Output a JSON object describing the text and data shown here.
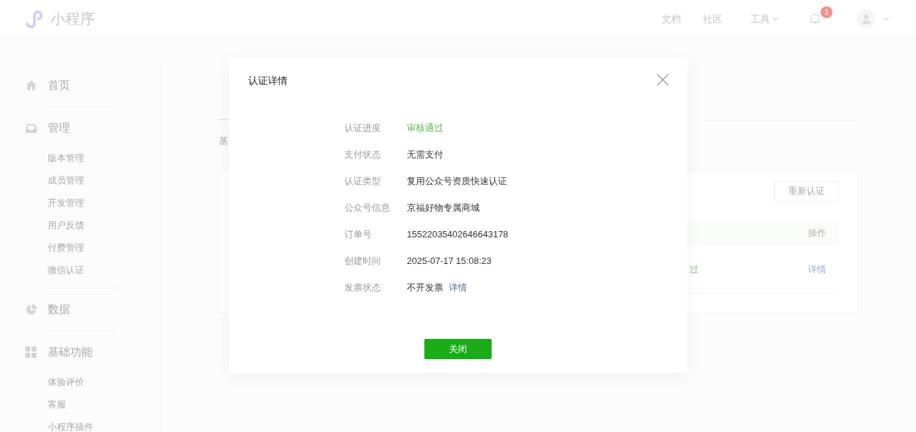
{
  "header": {
    "logo_text": "小程序",
    "nav": [
      {
        "label": "文档",
        "kind": "link"
      },
      {
        "label": "社区",
        "kind": "link"
      },
      {
        "label": "工具",
        "kind": "dropdown"
      }
    ],
    "notification_badge": "1"
  },
  "sidebar": [
    {
      "label": "首页"
    },
    {
      "label": "管理",
      "children": [
        "版本管理",
        "成员管理",
        "开发管理",
        "用户反馈",
        "付费管理",
        "微信认证"
      ]
    },
    {
      "label": "数据"
    },
    {
      "label": "基础功能",
      "children": [
        "体验评价",
        "客服",
        "小程序插件"
      ]
    }
  ],
  "main": {
    "tab": "基",
    "card": {
      "button": "重新认证",
      "table_header": "操作",
      "row": {
        "column_1": "过",
        "action": "详情"
      }
    }
  },
  "modal": {
    "title": "认证详情",
    "fields": [
      {
        "label": "认证进度",
        "value": "审核通过",
        "kind": "success"
      },
      {
        "label": "支付状态",
        "value": "无需支付",
        "kind": "plain"
      },
      {
        "label": "认证类型",
        "value": "复用公众号资质快速认证",
        "kind": "plain"
      },
      {
        "label": "公众号信息",
        "value": "京福好物专属商城",
        "kind": "plain"
      },
      {
        "label": "订单号",
        "value": "15522035402646643178",
        "kind": "plain"
      },
      {
        "label": "创建时间",
        "value": "2025-07-17 15:08:23",
        "kind": "plain"
      },
      {
        "label": "发票状态",
        "value": "不开发票",
        "kind": "plain",
        "link": "详情"
      }
    ],
    "button": "关闭"
  }
}
